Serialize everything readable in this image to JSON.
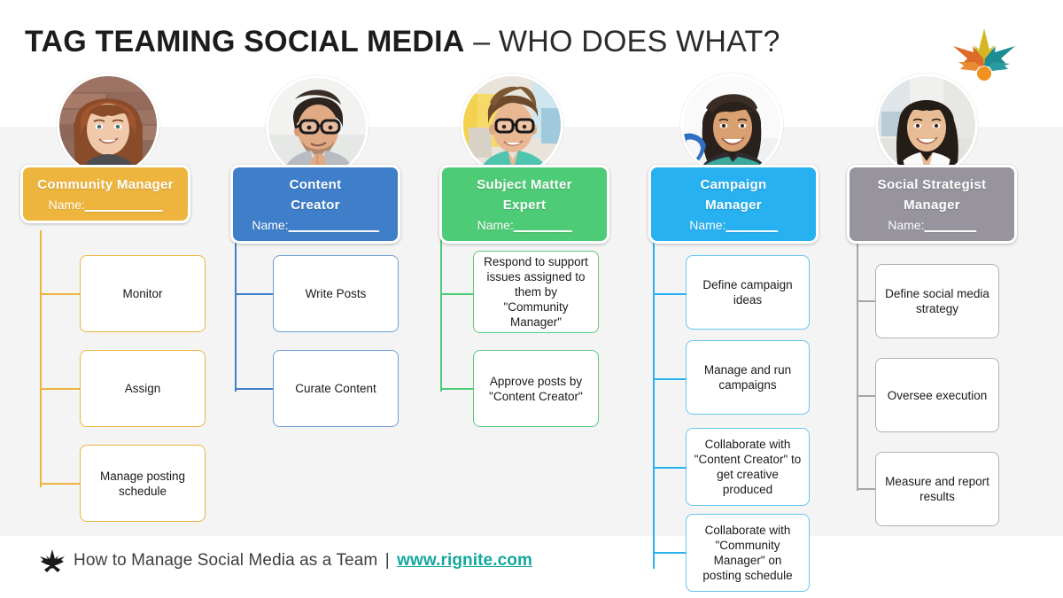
{
  "slide": {
    "title_strong": "TAG TEAMING SOCIAL MEDIA",
    "title_light": " – WHO DOES WHAT?",
    "background": "#ffffff",
    "band_color": "#f4f4f4"
  },
  "logo": {
    "name": "rignite-starburst-logo"
  },
  "columns": [
    {
      "id": "community-manager",
      "color": "#edb53d",
      "avatar": "avatar-woman-auburn-hair",
      "role_title_lines": [
        "Community Manager"
      ],
      "name_label": "Name:",
      "name_blank": "____________",
      "tasks": [
        {
          "text": "Monitor"
        },
        {
          "text": "Assign"
        },
        {
          "text": "Manage posting schedule"
        }
      ]
    },
    {
      "id": "content-creator",
      "color": "#3f7fca",
      "avatar": "avatar-man-glasses-blazer",
      "role_title_lines": [
        "Content",
        "Creator"
      ],
      "name_label": "Name:",
      "name_blank": "______________",
      "tasks": [
        {
          "text": "Write Posts"
        },
        {
          "text": "Curate Content"
        }
      ]
    },
    {
      "id": "subject-matter-expert",
      "color": "#4ecb77",
      "avatar": "avatar-man-curly-hair-mint-shirt",
      "role_title_lines": [
        "Subject Matter",
        "Expert"
      ],
      "name_label": "Name:",
      "name_blank": "_________",
      "tasks": [
        {
          "text": "Respond to support issues assigned to them by \"Community Manager\""
        },
        {
          "text": "Approve posts by \"Content Creator\""
        }
      ]
    },
    {
      "id": "campaign-manager",
      "color": "#27b1f0",
      "avatar": "avatar-woman-dark-curly-hair",
      "role_title_lines": [
        "Campaign",
        "Manager"
      ],
      "name_label": "Name:",
      "name_blank": "________",
      "tasks": [
        {
          "text": "Define campaign ideas"
        },
        {
          "text": "Manage and run campaigns"
        },
        {
          "text": "Collaborate with \"Content Creator\" to get creative produced"
        },
        {
          "text": "Collaborate with \"Community Manager\" on posting schedule"
        }
      ]
    },
    {
      "id": "social-strategist-manager",
      "color": "#97949e",
      "avatar": "avatar-woman-straight-dark-hair",
      "role_title_lines": [
        "Social Strategist",
        "Manager"
      ],
      "name_label": "Name:",
      "name_blank": "________",
      "tasks": [
        {
          "text": "Define social media strategy"
        },
        {
          "text": "Oversee execution"
        },
        {
          "text": "Measure and report results"
        }
      ]
    }
  ],
  "footer": {
    "text": "How to Manage Social Media as a Team",
    "separator": "|",
    "url": "www.rignite.com",
    "url_color": "#13a89e"
  }
}
